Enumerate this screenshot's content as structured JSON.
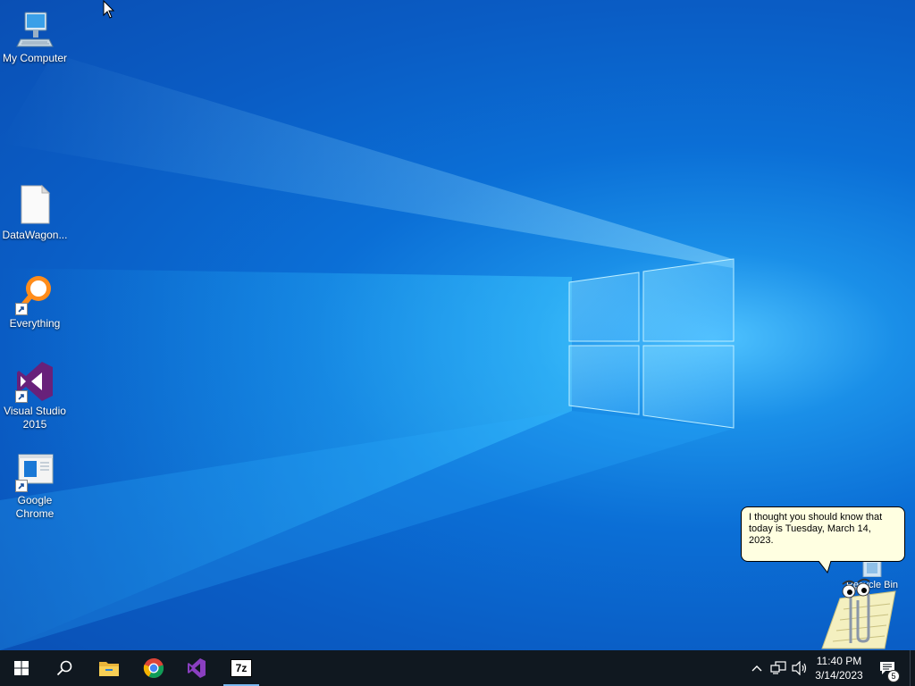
{
  "desktop": {
    "icons": [
      {
        "label": "My Computer",
        "icon": "computer-icon"
      },
      {
        "label": "DataWagon...",
        "icon": "file-icon"
      },
      {
        "label": "Everything",
        "icon": "everything-search-icon"
      },
      {
        "label": "Visual Studio 2015",
        "icon": "visual-studio-icon"
      },
      {
        "label": "Google Chrome",
        "icon": "chrome-shortcut-icon"
      }
    ],
    "recycle_bin": "Recycle Bin"
  },
  "clippy": {
    "message": "I thought you should know that today is Tuesday, March 14, 2023."
  },
  "taskbar": {
    "pinned": [
      {
        "name": "start-icon"
      },
      {
        "name": "search-icon"
      },
      {
        "name": "file-explorer-icon"
      },
      {
        "name": "chrome-icon"
      },
      {
        "name": "visual-studio-icon"
      },
      {
        "name": "7zip-icon",
        "text": "7z"
      }
    ],
    "tray": {
      "chevron": "^",
      "time": "11:40 PM",
      "date": "3/14/2023",
      "notification_count": "5"
    }
  },
  "colors": {
    "taskbar": "#101820",
    "balloon": "#ffffe1",
    "active_indicator": "#7ab8f0"
  }
}
